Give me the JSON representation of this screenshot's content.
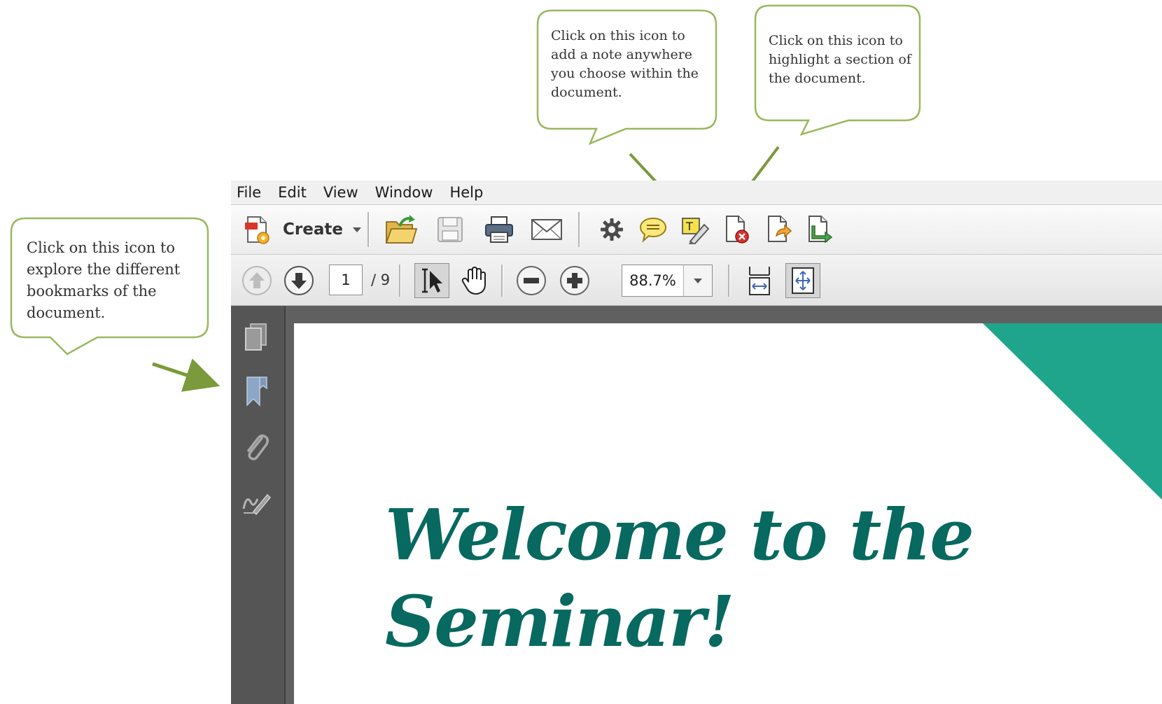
{
  "callouts": {
    "bookmarks": "Click on this icon to explore the different bookmarks of the document.",
    "note": "Click on this icon to add a note anywhere you choose within the document.",
    "highlight": "Click on this icon to highlight a section of the document."
  },
  "menubar": {
    "items": [
      "File",
      "Edit",
      "View",
      "Window",
      "Help"
    ]
  },
  "toolbar": {
    "create_label": "Create"
  },
  "navigation": {
    "current_page": "1",
    "total_pages": "/ 9",
    "zoom": "88.7%"
  },
  "document": {
    "title_line1": "Welcome to the",
    "title_line2": "Seminar!"
  },
  "colors": {
    "callout_border": "#9ab85e",
    "arrow": "#7a9a3c",
    "doc_title": "#07695f",
    "accent_triangle": "#1fa58b"
  }
}
